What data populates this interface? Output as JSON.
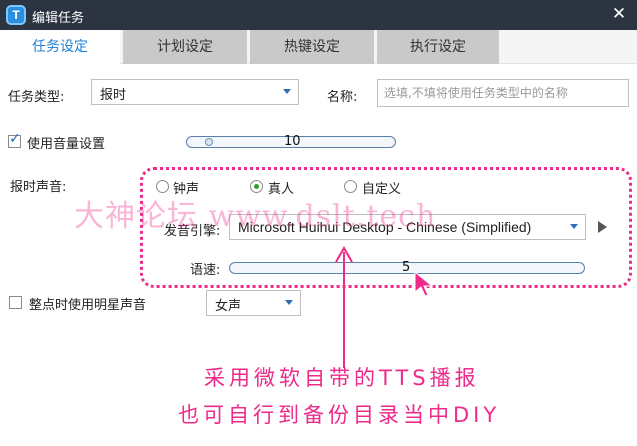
{
  "window": {
    "title": "编辑任务",
    "app_icon": "T"
  },
  "tabs": [
    {
      "label": "任务设定",
      "active": true
    },
    {
      "label": "计划设定",
      "active": false
    },
    {
      "label": "热键设定",
      "active": false
    },
    {
      "label": "执行设定",
      "active": false
    }
  ],
  "task": {
    "type_label": "任务类型:",
    "type_value": "报时",
    "name_label": "名称:",
    "name_placeholder": "选填,不填将使用任务类型中的名称",
    "name_value": ""
  },
  "volume": {
    "label": "使用音量设置",
    "checked": true,
    "value": "10"
  },
  "voice": {
    "label": "报时声音:",
    "options": [
      {
        "label": "钟声",
        "selected": false
      },
      {
        "label": "真人",
        "selected": true
      },
      {
        "label": "自定义",
        "selected": false
      }
    ],
    "engine_label": "发音引擎:",
    "engine_value": "Microsoft Huihui Desktop - Chinese (Simplified)",
    "speed_label": "语速:",
    "speed_value": "5"
  },
  "star_voice": {
    "label": "整点时使用明星声音",
    "checked": false,
    "value": "女声"
  },
  "overlay": {
    "watermark": "大神论坛  www.dslt.tech",
    "note_line1": "采用微软自带的TTS播报",
    "note_line2": "也可自行到备份目录当中DIY",
    "color": "#ee2a8a"
  }
}
